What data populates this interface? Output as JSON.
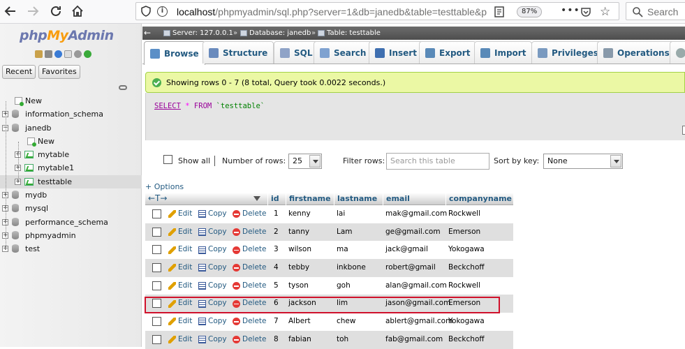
{
  "browser": {
    "url_host": "localhost",
    "url_rest": "/phpmyadmin/sql.php?server=1&db=janedb&table=testtable&p",
    "zoom": "87%",
    "search_placeholder": "Search"
  },
  "sidebar": {
    "logo": {
      "php": "php",
      "my": "My",
      "admin": "Admin"
    },
    "recent_label": "Recent",
    "favorites_label": "Favorites",
    "tree": [
      {
        "label": "New",
        "type": "new",
        "level": 0
      },
      {
        "label": "information_schema",
        "type": "db",
        "level": 0
      },
      {
        "label": "janedb",
        "type": "db",
        "level": 0,
        "expanded": true
      },
      {
        "label": "New",
        "type": "new",
        "level": 1
      },
      {
        "label": "mytable",
        "type": "table",
        "level": 1
      },
      {
        "label": "mytable1",
        "type": "table",
        "level": 1
      },
      {
        "label": "testtable",
        "type": "table",
        "level": 1,
        "selected": true
      },
      {
        "label": "mydb",
        "type": "db",
        "level": 0
      },
      {
        "label": "mysql",
        "type": "db",
        "level": 0
      },
      {
        "label": "performance_schema",
        "type": "db",
        "level": 0
      },
      {
        "label": "phpmyadmin",
        "type": "db",
        "level": 0
      },
      {
        "label": "test",
        "type": "db",
        "level": 0
      }
    ]
  },
  "breadcrumb": {
    "server": "Server: 127.0.0.1",
    "database": "Database: janedb",
    "table": "Table: testtable",
    "separator": "»"
  },
  "tabs": [
    {
      "label": "Browse",
      "active": true,
      "color": "#5b8fc7"
    },
    {
      "label": "Structure",
      "color": "#6a8bbd"
    },
    {
      "label": "SQL",
      "color": "#8fa3c7"
    },
    {
      "label": "Search",
      "color": "#7fa2d0"
    },
    {
      "label": "Insert",
      "color": "#3f6fb0"
    },
    {
      "label": "Export",
      "color": "#5a8ab8"
    },
    {
      "label": "Import",
      "color": "#5a8ab8"
    },
    {
      "label": "Privileges",
      "color": "#7a9ac0"
    },
    {
      "label": "Operations",
      "color": "#8899aa"
    }
  ],
  "message": "Showing rows 0 - 7 (8 total, Query took 0.0022 seconds.)",
  "sql": {
    "select": "SELECT",
    "star": "*",
    "from": "FROM",
    "table": "`testtable`"
  },
  "navigation": {
    "show_all": "Show all",
    "number_of_rows_label": "Number of rows:",
    "number_of_rows_value": "25",
    "filter_rows_label": "Filter rows:",
    "filter_placeholder": "Search this table",
    "sort_by_key_label": "Sort by key:",
    "sort_by_key_value": "None"
  },
  "options_link": "+ Options",
  "columns": [
    "id",
    "firstname",
    "lastname",
    "email",
    "companyname"
  ],
  "actions": {
    "edit": "Edit",
    "copy": "Copy",
    "delete": "Delete"
  },
  "rows": [
    {
      "id": "1",
      "firstname": "kenny",
      "lastname": "lai",
      "email": "mak@gmail.com",
      "companyname": "Rockwell"
    },
    {
      "id": "2",
      "firstname": "tanny",
      "lastname": "Lam",
      "email": "ge@gmail.com",
      "companyname": "Emerson"
    },
    {
      "id": "3",
      "firstname": "wilson",
      "lastname": "ma",
      "email": "jack@gmail",
      "companyname": "Yokogawa"
    },
    {
      "id": "4",
      "firstname": "tebby",
      "lastname": "inkbone",
      "email": "robert@gmail",
      "companyname": "Beckchoff"
    },
    {
      "id": "5",
      "firstname": "tyson",
      "lastname": "goh",
      "email": "alan@gmail.com",
      "companyname": "Rockwell"
    },
    {
      "id": "6",
      "firstname": "jackson",
      "lastname": "lim",
      "email": "jason@gmail.com",
      "companyname": "Emerson",
      "highlighted": true
    },
    {
      "id": "7",
      "firstname": "Albert",
      "lastname": "chew",
      "email": "ablert@gmail.com",
      "companyname": "Yokogawa"
    },
    {
      "id": "8",
      "firstname": "fabian",
      "lastname": "toh",
      "email": "fab@gmail.com",
      "companyname": "Beckchoff"
    }
  ]
}
